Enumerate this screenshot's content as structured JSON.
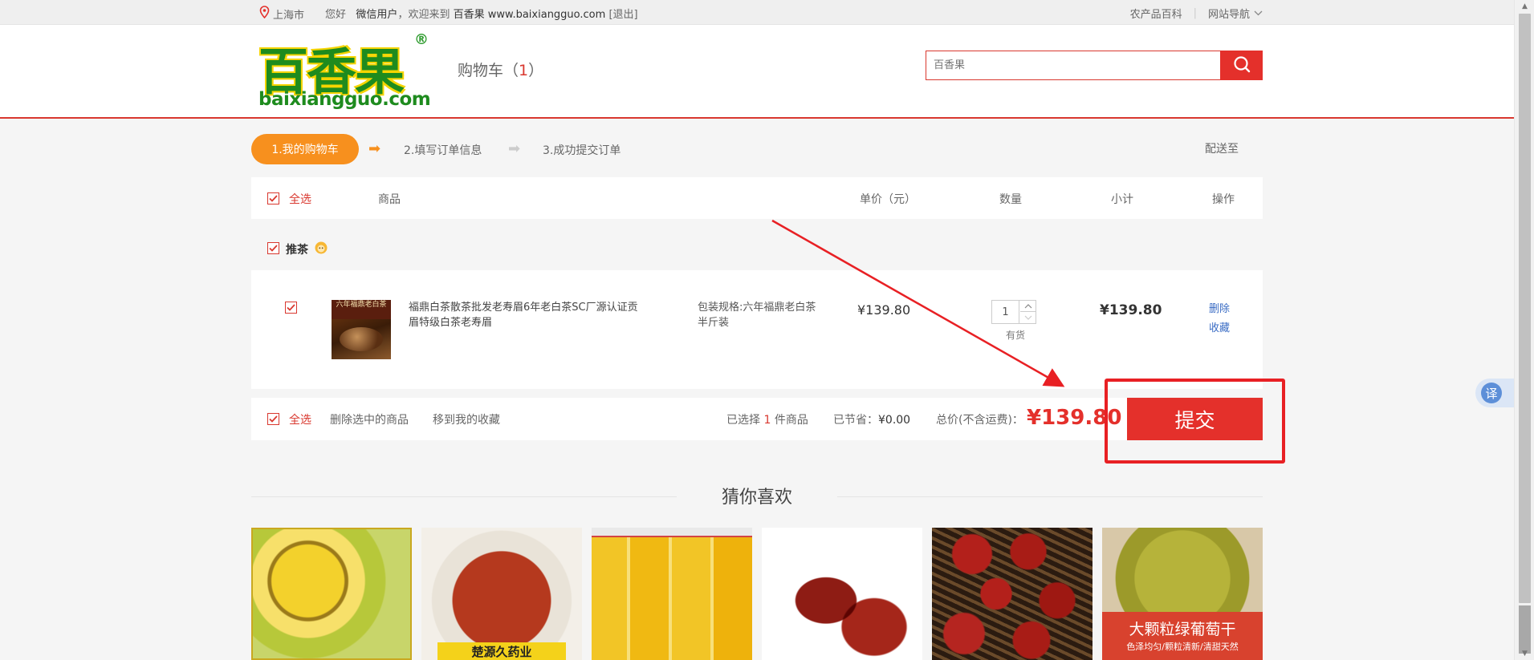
{
  "topbar": {
    "location": "上海市",
    "greeting": "您好",
    "user": "微信用户",
    "welcome": "，欢迎来到",
    "site": "百香果",
    "url": "www.baixiangguo.com",
    "logout": "[退出]",
    "right_links": [
      "农产品百科",
      "网站导航"
    ]
  },
  "header": {
    "logo_cn": "百香果",
    "logo_en": "baixiangguo.com",
    "logo_reg": "®",
    "cart_label": "购物车（",
    "cart_count": "1",
    "cart_close": "）",
    "search_placeholder": "百香果"
  },
  "steps": {
    "items": [
      "1.我的购物车",
      "2.填写订单信息",
      "3.成功提交订单"
    ],
    "ship_to": "配送至"
  },
  "table": {
    "select_all": "全选",
    "columns": [
      "商品",
      "单价（元）",
      "数量",
      "小计",
      "操作"
    ]
  },
  "shop": {
    "name": "推茶"
  },
  "item": {
    "thumb_text": "六年福鼎老白茶",
    "name": "福鼎白茶散茶批发老寿眉6年老白茶SC厂源认证贡眉特级白茶老寿眉",
    "spec": "包装规格:六年福鼎老白茶半斤装",
    "unit_price": "¥139.80",
    "quantity": "1",
    "stock": "有货",
    "subtotal": "¥139.80",
    "ops": [
      "删除",
      "收藏"
    ]
  },
  "footer": {
    "select_all": "全选",
    "delete_selected": "删除选中的商品",
    "move_fav": "移到我的收藏",
    "selected_prefix": "已选择",
    "selected_count": "1",
    "selected_suffix": "件商品",
    "saved_label": "已节省：",
    "saved_value": "¥0.00",
    "total_label": "总价(不含运费)：",
    "total_value": "¥139.80",
    "submit": "提交"
  },
  "recommend": {
    "title": "猜你喜欢",
    "p2_label": "楚源久药业",
    "p6_title": "大颗粒绿葡萄干",
    "p6_sub": "色泽均匀/颗粒清新/清甜天然"
  },
  "widgets": {
    "translate": "译"
  },
  "colors": {
    "accent_red": "#e4302b",
    "step_orange": "#f7901e",
    "link_blue": "#3a6cc4"
  }
}
